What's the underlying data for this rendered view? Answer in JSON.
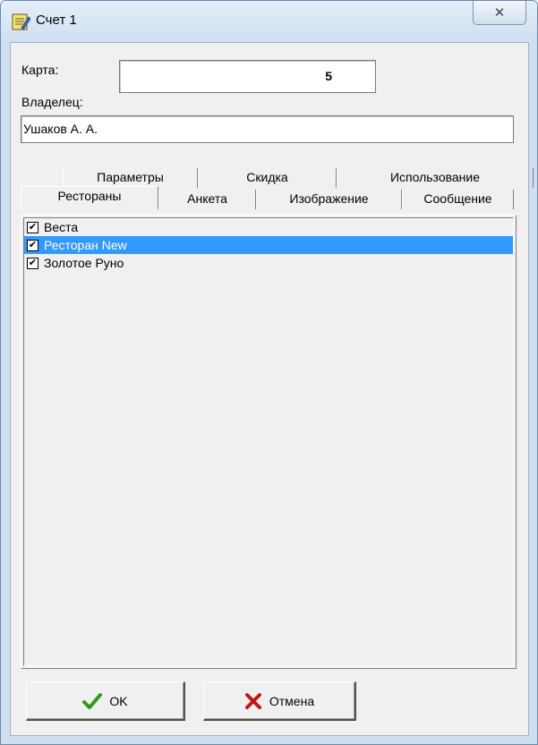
{
  "window": {
    "title": "Счет 1",
    "close_glyph": "✕",
    "title_icon": "notepad-app-icon"
  },
  "form": {
    "card_label": "Карта:",
    "card_value": "5",
    "owner_label": "Владелец:",
    "owner_value": "Ушаков А. А."
  },
  "tabs": {
    "row1": [
      "Параметры",
      "Скидка",
      "Использование"
    ],
    "row2": [
      "Рестораны",
      "Анкета",
      "Изображение",
      "Сообщение"
    ],
    "active": "Рестораны"
  },
  "restaurants": [
    {
      "label": "Веста",
      "checked": true,
      "selected": false
    },
    {
      "label": "Ресторан New",
      "checked": true,
      "selected": true
    },
    {
      "label": "Золотое Руно",
      "checked": true,
      "selected": false
    }
  ],
  "buttons": {
    "ok_label": "OK",
    "ok_icon": "checkmark-icon",
    "ok_color": "#2e9a1a",
    "cancel_label": "Отмена",
    "cancel_icon": "cross-icon",
    "cancel_color": "#c01818"
  },
  "colors": {
    "selection": "#3399ff",
    "dialog_bg": "#f0f0f0"
  }
}
